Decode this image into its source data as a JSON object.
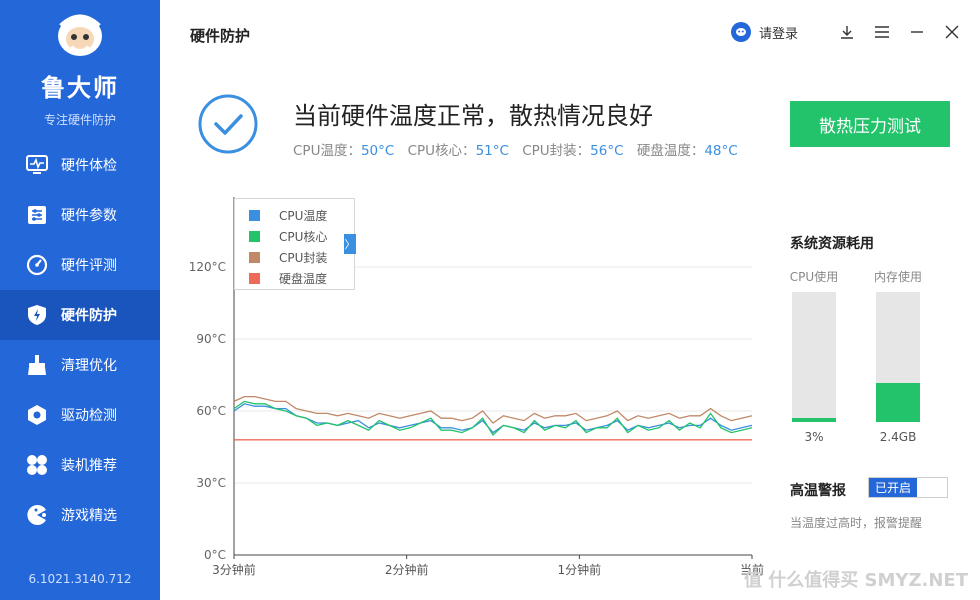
{
  "sidebar": {
    "brand": "鲁大师",
    "tagline": "专注硬件防护",
    "version": "6.1021.3140.712",
    "items": [
      {
        "label": "硬件体检"
      },
      {
        "label": "硬件参数"
      },
      {
        "label": "硬件评测"
      },
      {
        "label": "硬件防护"
      },
      {
        "label": "清理优化"
      },
      {
        "label": "驱动检测"
      },
      {
        "label": "装机推荐"
      },
      {
        "label": "游戏精选"
      }
    ]
  },
  "header": {
    "title": "硬件防护",
    "login_label": "请登录"
  },
  "status": {
    "headline": "当前硬件温度正常，散热情况良好",
    "temps": [
      {
        "label": "CPU温度：",
        "value": "50°C"
      },
      {
        "label": "CPU核心：",
        "value": "51°C"
      },
      {
        "label": "CPU封装：",
        "value": "56°C"
      },
      {
        "label": "硬盘温度：",
        "value": "48°C"
      }
    ],
    "stress_button": "散热压力测试"
  },
  "resources": {
    "title": "系统资源耗用",
    "cpu_label": "CPU使用",
    "cpu_value": "3%",
    "cpu_fraction": 0.03,
    "mem_label": "内存使用",
    "mem_value": "2.4GB",
    "mem_fraction": 0.3
  },
  "alarm": {
    "label": "高温警报",
    "toggle_label": "已开启",
    "description": "当温度过高时，报警提醒"
  },
  "watermark": "值 什么值得买 SMYZ.NET",
  "colors": {
    "sidebar": "#2467d9",
    "accent_green": "#22c36b",
    "value_blue": "#3b8fe0"
  },
  "chart_data": {
    "type": "line",
    "x_tick_labels": [
      "3分钟前",
      "2分钟前",
      "1分钟前",
      "当前"
    ],
    "y_tick_labels": [
      "0°C",
      "30°C",
      "60°C",
      "90°C",
      "120°C"
    ],
    "ylim": [
      0,
      120
    ],
    "grid": true,
    "legend_position": "top-left",
    "series": [
      {
        "name": "CPU温度",
        "color": "#3b8fe0",
        "values": [
          60,
          63,
          62,
          62,
          61,
          61,
          58,
          57,
          55,
          55,
          54,
          55,
          56,
          53,
          55,
          54,
          53,
          54,
          55,
          56,
          53,
          53,
          52,
          53,
          56,
          51,
          54,
          53,
          52,
          55,
          53,
          54,
          54,
          55,
          52,
          53,
          54,
          56,
          52,
          54,
          53,
          54,
          55,
          53,
          54,
          54,
          57,
          54,
          52,
          53,
          54
        ]
      },
      {
        "name": "CPU核心",
        "color": "#22c36b",
        "values": [
          61,
          64,
          63,
          63,
          61,
          60,
          58,
          57,
          54,
          55,
          54,
          56,
          54,
          52,
          56,
          54,
          52,
          53,
          55,
          57,
          52,
          52,
          51,
          53,
          57,
          50,
          54,
          53,
          51,
          56,
          52,
          54,
          53,
          56,
          51,
          53,
          53,
          57,
          51,
          54,
          52,
          53,
          56,
          52,
          55,
          53,
          59,
          53,
          51,
          52,
          53
        ]
      },
      {
        "name": "CPU封装",
        "color": "#c08867",
        "values": [
          64,
          66,
          66,
          65,
          64,
          64,
          61,
          60,
          59,
          59,
          58,
          59,
          58,
          57,
          59,
          58,
          57,
          58,
          59,
          60,
          57,
          57,
          56,
          57,
          60,
          55,
          58,
          57,
          56,
          59,
          57,
          58,
          58,
          59,
          56,
          57,
          58,
          60,
          56,
          58,
          57,
          58,
          59,
          57,
          58,
          58,
          61,
          58,
          56,
          57,
          58
        ]
      },
      {
        "name": "硬盘温度",
        "color": "#ee6b5a",
        "values": [
          48,
          48,
          48,
          48,
          48,
          48,
          48,
          48,
          48,
          48,
          48,
          48,
          48,
          48,
          48,
          48,
          48,
          48,
          48,
          48,
          48,
          48,
          48,
          48,
          48,
          48,
          48,
          48,
          48,
          48,
          48,
          48,
          48,
          48,
          48,
          48,
          48,
          48,
          48,
          48,
          48,
          48,
          48,
          48,
          48,
          48,
          48,
          48,
          48,
          48,
          48
        ]
      }
    ]
  }
}
